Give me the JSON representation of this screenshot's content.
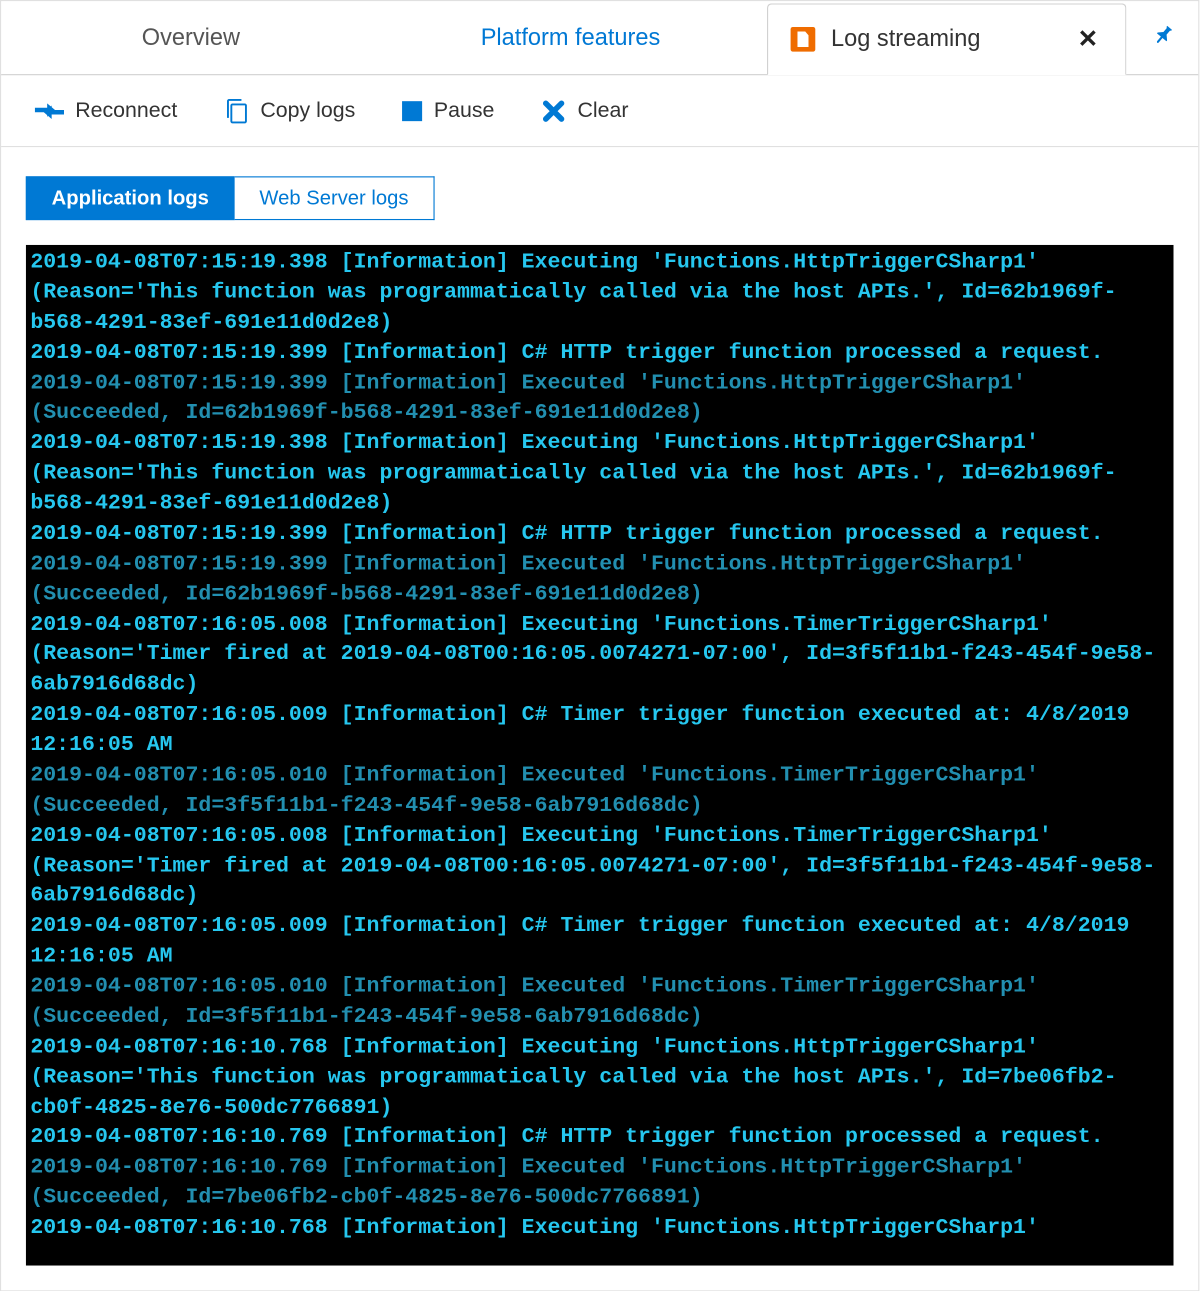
{
  "tabs": {
    "overview": "Overview",
    "platform": "Platform features",
    "log_streaming": "Log streaming"
  },
  "toolbar": {
    "reconnect": "Reconnect",
    "copy": "Copy logs",
    "pause": "Pause",
    "clear": "Clear"
  },
  "log_tabs": {
    "app": "Application logs",
    "web": "Web Server logs"
  },
  "logs": [
    {
      "cls": "bright",
      "text": "2019-04-08T07:15:19.398 [Information] Executing 'Functions.HttpTriggerCSharp1' (Reason='This function was programmatically called via the host APIs.', Id=62b1969f-b568-4291-83ef-691e11d0d2e8)"
    },
    {
      "cls": "bright",
      "text": "2019-04-08T07:15:19.399 [Information] C# HTTP trigger function processed a request."
    },
    {
      "cls": "dim",
      "text": "2019-04-08T07:15:19.399 [Information] Executed 'Functions.HttpTriggerCSharp1' (Succeeded, Id=62b1969f-b568-4291-83ef-691e11d0d2e8)"
    },
    {
      "cls": "bright",
      "text": "2019-04-08T07:15:19.398 [Information] Executing 'Functions.HttpTriggerCSharp1' (Reason='This function was programmatically called via the host APIs.', Id=62b1969f-b568-4291-83ef-691e11d0d2e8)"
    },
    {
      "cls": "bright",
      "text": "2019-04-08T07:15:19.399 [Information] C# HTTP trigger function processed a request."
    },
    {
      "cls": "dim",
      "text": "2019-04-08T07:15:19.399 [Information] Executed 'Functions.HttpTriggerCSharp1' (Succeeded, Id=62b1969f-b568-4291-83ef-691e11d0d2e8)"
    },
    {
      "cls": "bright",
      "text": "2019-04-08T07:16:05.008 [Information] Executing 'Functions.TimerTriggerCSharp1' (Reason='Timer fired at 2019-04-08T00:16:05.0074271-07:00', Id=3f5f11b1-f243-454f-9e58-6ab7916d68dc)"
    },
    {
      "cls": "bright",
      "text": "2019-04-08T07:16:05.009 [Information] C# Timer trigger function executed at: 4/8/2019 12:16:05 AM"
    },
    {
      "cls": "dim",
      "text": "2019-04-08T07:16:05.010 [Information] Executed 'Functions.TimerTriggerCSharp1' (Succeeded, Id=3f5f11b1-f243-454f-9e58-6ab7916d68dc)"
    },
    {
      "cls": "bright",
      "text": "2019-04-08T07:16:05.008 [Information] Executing 'Functions.TimerTriggerCSharp1' (Reason='Timer fired at 2019-04-08T00:16:05.0074271-07:00', Id=3f5f11b1-f243-454f-9e58-6ab7916d68dc)"
    },
    {
      "cls": "bright",
      "text": "2019-04-08T07:16:05.009 [Information] C# Timer trigger function executed at: 4/8/2019 12:16:05 AM"
    },
    {
      "cls": "dim",
      "text": "2019-04-08T07:16:05.010 [Information] Executed 'Functions.TimerTriggerCSharp1' (Succeeded, Id=3f5f11b1-f243-454f-9e58-6ab7916d68dc)"
    },
    {
      "cls": "bright",
      "text": "2019-04-08T07:16:10.768 [Information] Executing 'Functions.HttpTriggerCSharp1' (Reason='This function was programmatically called via the host APIs.', Id=7be06fb2-cb0f-4825-8e76-500dc7766891)"
    },
    {
      "cls": "bright",
      "text": "2019-04-08T07:16:10.769 [Information] C# HTTP trigger function processed a request."
    },
    {
      "cls": "dim",
      "text": "2019-04-08T07:16:10.769 [Information] Executed 'Functions.HttpTriggerCSharp1' (Succeeded, Id=7be06fb2-cb0f-4825-8e76-500dc7766891)"
    },
    {
      "cls": "bright",
      "text": "2019-04-08T07:16:10.768 [Information] Executing 'Functions.HttpTriggerCSharp1'"
    }
  ]
}
